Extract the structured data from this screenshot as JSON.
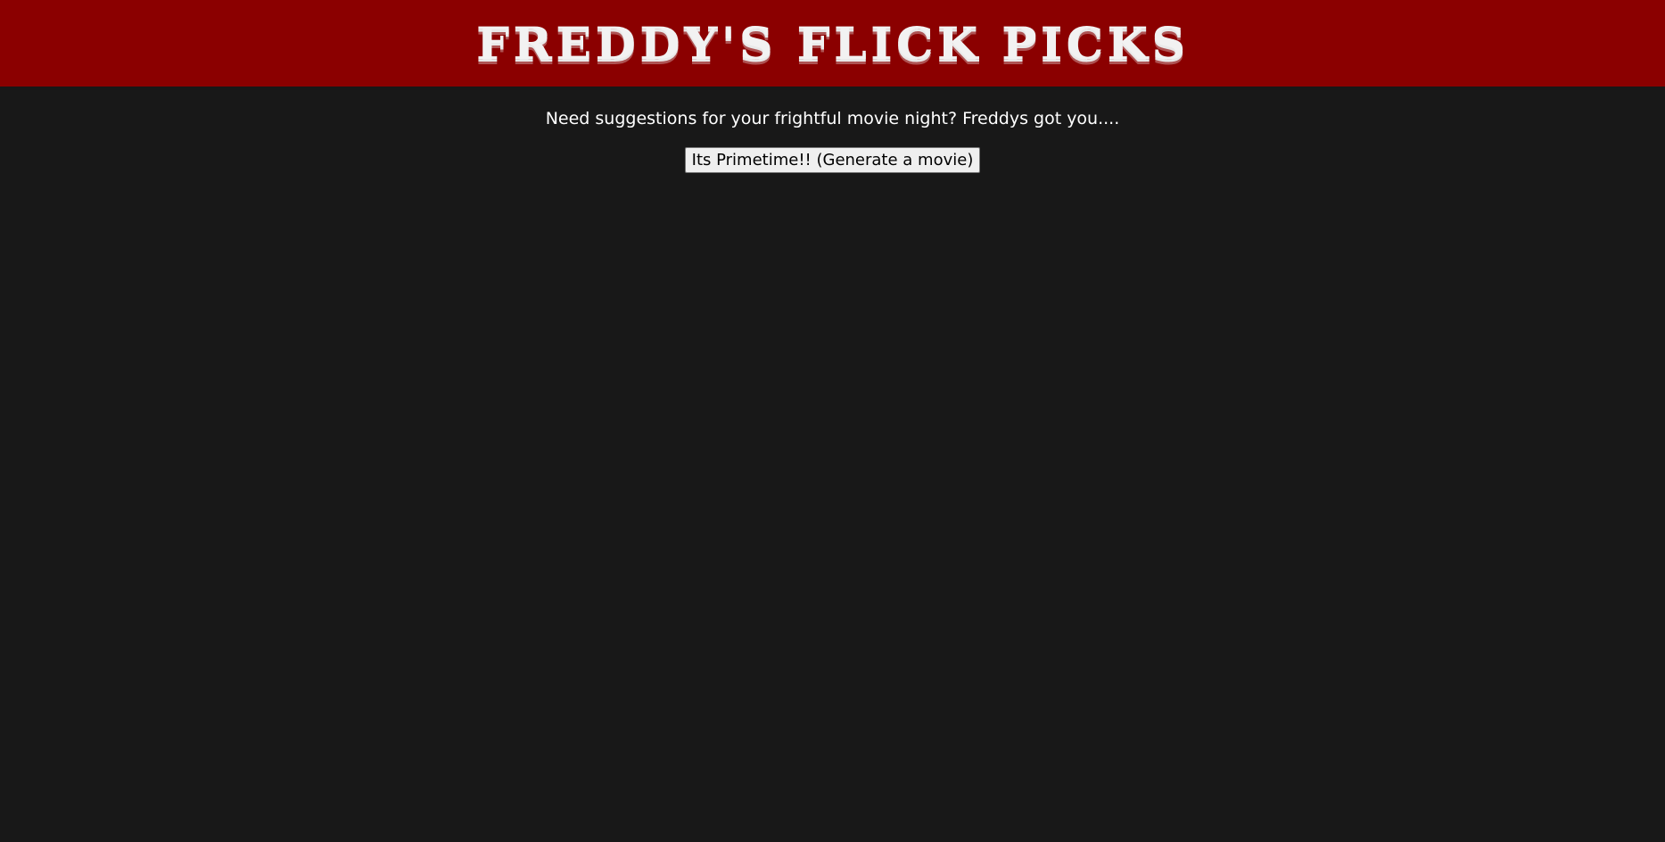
{
  "header": {
    "title": "Freddy's Flick Picks"
  },
  "main": {
    "tagline": "Need suggestions for your frightful movie night? Freddys got you....",
    "generate_button_label": "Its Primetime!! (Generate a movie)"
  },
  "colors": {
    "header_background": "#8b0000",
    "page_background": "#181818",
    "text": "#ffffff"
  }
}
